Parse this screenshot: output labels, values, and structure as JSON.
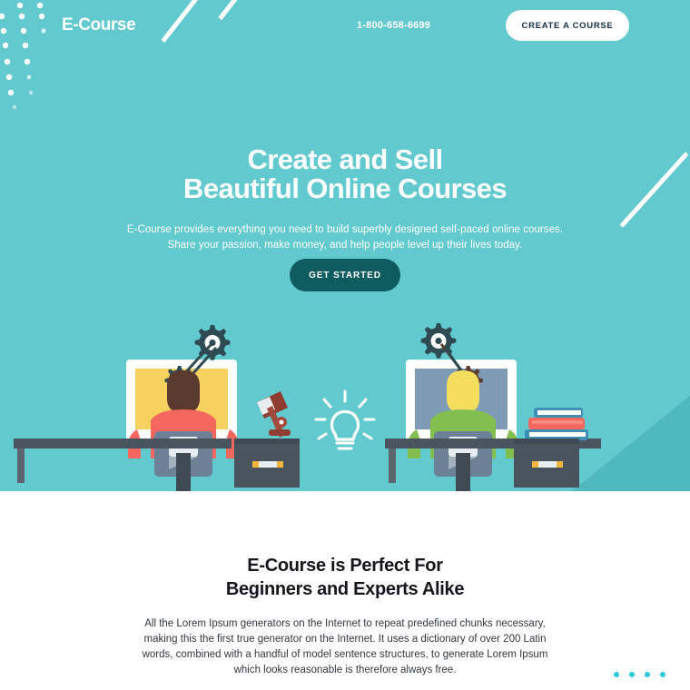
{
  "nav": {
    "logo": "E-Course",
    "phone": "1-800-658-6699",
    "cta_label": "CREATE A COURSE"
  },
  "hero": {
    "title_line1": "Create and Sell",
    "title_line2": "Beautiful Online Courses",
    "sub_line1": "E-Course provides everything you need to build superbly designed self-paced online courses.",
    "sub_line2": "Share your passion, make money, and help people level up their lives today.",
    "button_label": "GET STARTED",
    "background_color": "#62c9cf",
    "button_color": "#0f5c60",
    "corner_color": "#4fb9bf"
  },
  "illustration": {
    "left_person": {
      "hair_color": "#5b3a2e",
      "shirt_color": "#f4675e",
      "screen_color": "#f7d15f",
      "gear_color": "#2e4a52",
      "prop": "desk-lamp",
      "lamp_color": "#a24a3c"
    },
    "right_person": {
      "hair_color": "#f5dd5d",
      "shirt_color": "#83bf4f",
      "screen_color": "#7d9bb5",
      "gear_color": "#2e4a52",
      "prop": "book-stack",
      "book_colors": [
        "#3d8fb5",
        "#f4675e",
        "#3d8fb5"
      ]
    },
    "center_icon": "lightbulb-icon",
    "desk_color": "#4a545e"
  },
  "section2": {
    "title_line1": "E-Course is Perfect For",
    "title_line2": "Beginners and Experts Alike",
    "body": "All the Lorem Ipsum generators on the Internet to repeat predefined chunks necessary, making this the first true generator on the Internet. It uses a dictionary of over 200 Latin words, combined with a handful of model sentence structures, to generate Lorem Ipsum which looks reasonable is therefore always free.",
    "carousel_dots": 4,
    "dot_color": "#2ac9dd"
  }
}
